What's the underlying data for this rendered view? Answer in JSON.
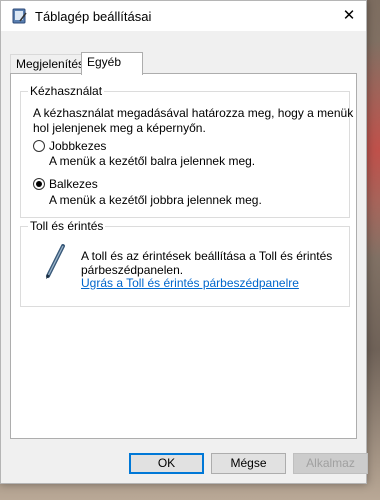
{
  "window": {
    "title": "Táblagép beállításai",
    "close_glyph": "✕"
  },
  "tabs": [
    {
      "label": "Megjelenítés",
      "active": false
    },
    {
      "label": "Egyéb",
      "active": true
    }
  ],
  "handedness": {
    "group_title": "Kézhasználat",
    "description_line1": "A kézhasználat megadásával határozza meg, hogy a menük",
    "description_line2": "hol jelenjenek meg a képernyőn.",
    "options": [
      {
        "label": "Jobbkezes",
        "hint": "A menük a kezétől balra jelennek meg.",
        "selected": false
      },
      {
        "label": "Balkezes",
        "hint": "A menük a kezétől jobbra jelennek meg.",
        "selected": true
      }
    ]
  },
  "pen_touch": {
    "group_title": "Toll és érintés",
    "text_line1": "A toll és az érintések beállítása a Toll és érintés",
    "text_line2": "párbeszédpanelen.",
    "link": "Ugrás a Toll és érintés párbeszédpanelre",
    "icon": "pen-icon"
  },
  "buttons": {
    "ok": "OK",
    "cancel": "Mégse",
    "apply": "Alkalmaz"
  },
  "colors": {
    "accent": "#0078d7",
    "link": "#0066cc",
    "dialog_bg": "#f0f0f0"
  }
}
